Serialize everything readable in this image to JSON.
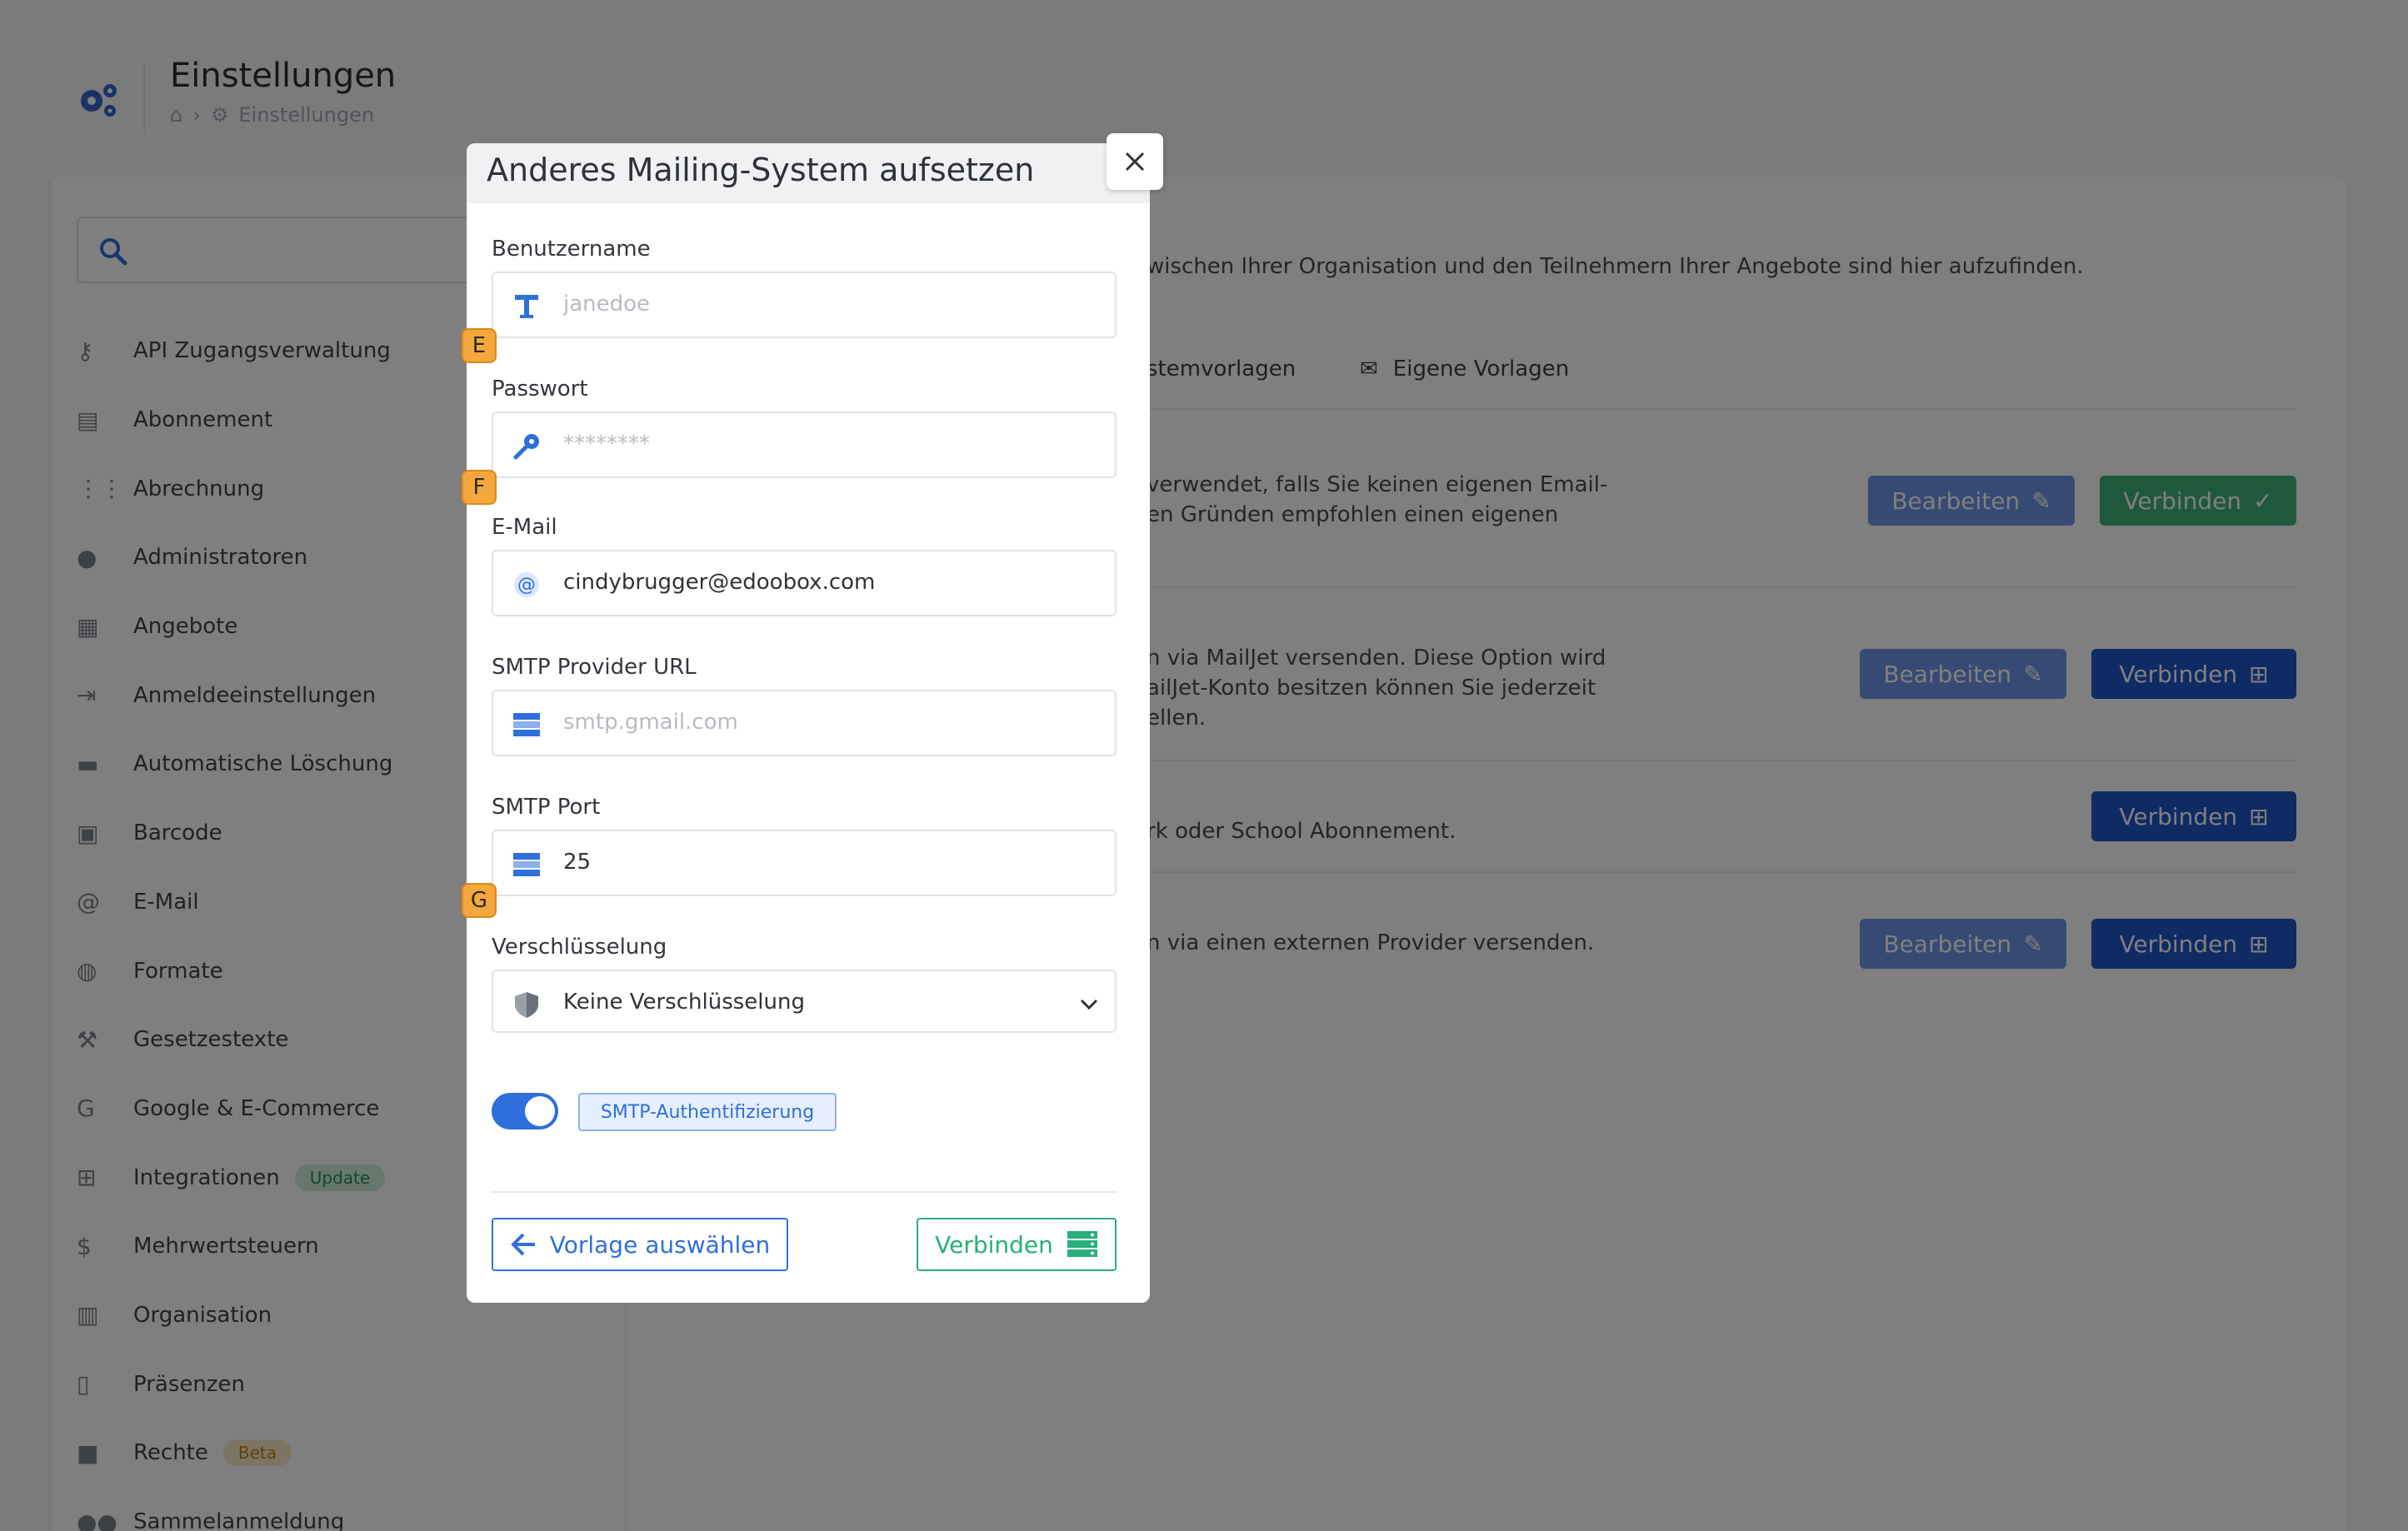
{
  "header": {
    "title": "Einstellungen",
    "breadcrumb_current": "Einstellungen"
  },
  "sidebar": {
    "items": [
      {
        "label": "API Zugangsverwaltung",
        "icon": "key-icon"
      },
      {
        "label": "Abonnement",
        "icon": "document-icon"
      },
      {
        "label": "Abrechnung",
        "icon": "abacus-icon"
      },
      {
        "label": "Administratoren",
        "icon": "user-shield-icon"
      },
      {
        "label": "Angebote",
        "icon": "boxes-icon"
      },
      {
        "label": "Anmeldeeinstellungen",
        "icon": "sign-in-icon"
      },
      {
        "label": "Automatische Löschung",
        "icon": "trash-icon"
      },
      {
        "label": "Barcode",
        "icon": "qrcode-icon"
      },
      {
        "label": "E-Mail",
        "icon": "at-icon"
      },
      {
        "label": "Formate",
        "icon": "globe-icon"
      },
      {
        "label": "Gesetzestexte",
        "icon": "gavel-icon"
      },
      {
        "label": "Google & E-Commerce",
        "icon": "google-icon"
      },
      {
        "label": "Integrationen",
        "icon": "network-icon",
        "badge": "Update"
      },
      {
        "label": "Mehrwertsteuern",
        "icon": "hand-dollar-icon"
      },
      {
        "label": "Organisation",
        "icon": "building-icon"
      },
      {
        "label": "Präsenzen",
        "icon": "clipboard-icon"
      },
      {
        "label": "Rechte",
        "icon": "lock-icon",
        "badge": "Beta"
      },
      {
        "label": "Sammelanmeldung",
        "icon": "users-icon"
      }
    ]
  },
  "main": {
    "intro": "wischen Ihrer Organisation und den Teilnehmern Ihrer Angebote sind hier aufzufinden.",
    "tabs": [
      "stemvorlagen",
      "Eigene Vorlagen"
    ],
    "rows": [
      {
        "line1": "verwendet, falls Sie keinen eigenen Email-",
        "line2": "en Gründen empfohlen einen eigenen",
        "line3": ""
      },
      {
        "line1": "n via MailJet versenden. Diese Option wird",
        "line2": "ailJet-Konto besitzen können Sie jederzeit",
        "line3": "ellen."
      },
      {
        "line1": "rk oder School Abonnement.",
        "line2": "",
        "line3": ""
      },
      {
        "line1": "n via einen externen Provider versenden.",
        "line2": "",
        "line3": ""
      }
    ],
    "edit_label": "Bearbeiten",
    "connect_label": "Verbinden"
  },
  "modal": {
    "title": "Anderes Mailing-System aufsetzen",
    "username": {
      "label": "Benutzername",
      "placeholder": "janedoe",
      "value": ""
    },
    "password": {
      "label": "Passwort",
      "placeholder": "********",
      "value": ""
    },
    "email": {
      "label": "E-Mail",
      "value": "cindybrugger@edoobox.com"
    },
    "smtp_url": {
      "label": "SMTP Provider URL",
      "placeholder": "smtp.gmail.com",
      "value": ""
    },
    "smtp_port": {
      "label": "SMTP Port",
      "value": "25"
    },
    "encryption": {
      "label": "Verschlüsselung",
      "value": "Keine Verschlüsselung"
    },
    "auth_toggle": {
      "label": "SMTP-Authentifizierung",
      "enabled": true
    },
    "back_label": "Vorlage auswählen",
    "connect_label": "Verbinden",
    "hints": [
      "E",
      "F",
      "G"
    ]
  },
  "colors": {
    "primary": "#1d56c9",
    "accent": "#2e6fdc",
    "success": "#27b07a",
    "hint": "#f4a73c"
  }
}
